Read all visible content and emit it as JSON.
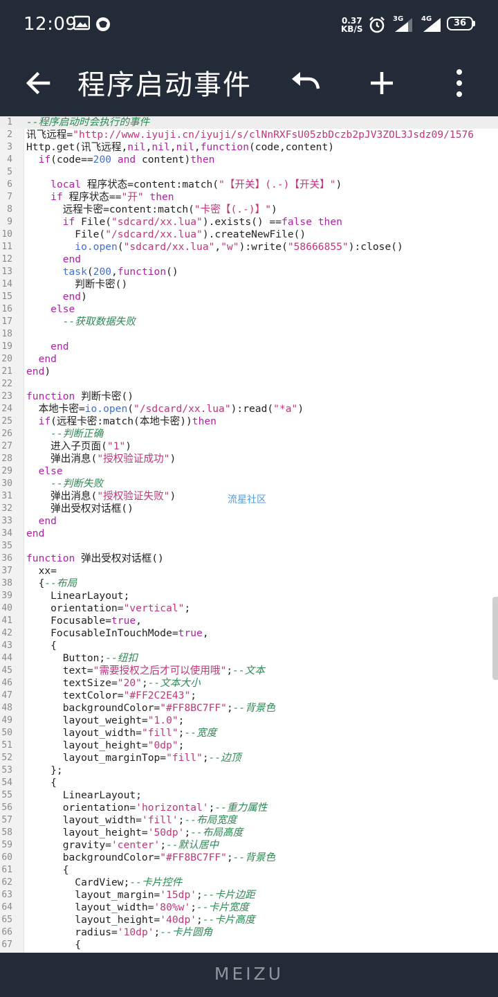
{
  "status_bar": {
    "time": "12:09",
    "net_speed_value": "0.37",
    "net_speed_unit": "KB/S",
    "sim1_label": "3G",
    "sim2_label": "4G",
    "battery": "36",
    "icons": [
      "image-notification-icon",
      "app-notification-icon",
      "alarm-icon",
      "signal-3g-icon",
      "signal-4g-icon",
      "battery-icon"
    ]
  },
  "app_bar": {
    "title": "程序启动事件",
    "icons": [
      "back-arrow-icon",
      "undo-icon",
      "add-icon",
      "more-vert-icon"
    ]
  },
  "editor": {
    "current_line": 1,
    "watermark": "流星社区",
    "lines": [
      [
        [
          "cm",
          "--程序启动时会执行的事件"
        ]
      ],
      [
        [
          "",
          "讯飞远程="
        ],
        [
          "st",
          "\"http://www.iyuji.cn/iyuji/s/clNnRXFsU05zbDczb2pJV3ZOL3Jsdz09/1576"
        ]
      ],
      [
        [
          "",
          "Http.get(讯飞远程,"
        ],
        [
          "kw",
          "nil"
        ],
        [
          "",
          ","
        ],
        [
          "kw",
          "nil"
        ],
        [
          "",
          ","
        ],
        [
          "kw",
          "nil"
        ],
        [
          "",
          ","
        ],
        [
          "kw",
          "function"
        ],
        [
          "",
          "(code,content)"
        ]
      ],
      [
        [
          "",
          "  "
        ],
        [
          "kw",
          "if"
        ],
        [
          "",
          "(code=="
        ],
        [
          "nm",
          "200"
        ],
        [
          "kw",
          " and"
        ],
        [
          "",
          " content)"
        ],
        [
          "kw",
          "then"
        ]
      ],
      [
        [
          "",
          ""
        ]
      ],
      [
        [
          "",
          "    "
        ],
        [
          "kw",
          "local"
        ],
        [
          "",
          " 程序状态=content:match("
        ],
        [
          "st",
          "\"【开关】(.-)【开关】\""
        ],
        [
          "",
          ")"
        ]
      ],
      [
        [
          "",
          "    "
        ],
        [
          "kw",
          "if"
        ],
        [
          "",
          " 程序状态=="
        ],
        [
          "st",
          "\"开\""
        ],
        [
          "kw",
          " then"
        ]
      ],
      [
        [
          "",
          "      远程卡密=content:match("
        ],
        [
          "st",
          "\"卡密【(.-)】\""
        ],
        [
          "",
          ")"
        ]
      ],
      [
        [
          "",
          "      "
        ],
        [
          "kw",
          "if"
        ],
        [
          "",
          " File("
        ],
        [
          "st",
          "\"sdcard/xx.lua\""
        ],
        [
          "",
          ").exists() =="
        ],
        [
          "kw",
          "false"
        ],
        [
          "kw",
          " then"
        ]
      ],
      [
        [
          "",
          "        File("
        ],
        [
          "st",
          "\"/sdcard/xx.lua\""
        ],
        [
          "",
          ").createNewFile()"
        ]
      ],
      [
        [
          "",
          "        "
        ],
        [
          "nm",
          "io.open"
        ],
        [
          "",
          "("
        ],
        [
          "st",
          "\"sdcard/xx.lua\""
        ],
        [
          "",
          ","
        ],
        [
          "st",
          "\"w\""
        ],
        [
          "",
          "):write("
        ],
        [
          "st",
          "\"58666855\""
        ],
        [
          "",
          "):close()"
        ]
      ],
      [
        [
          "",
          "      "
        ],
        [
          "kw",
          "end"
        ]
      ],
      [
        [
          "",
          "      "
        ],
        [
          "nm",
          "task"
        ],
        [
          "",
          "("
        ],
        [
          "nm",
          "200"
        ],
        [
          "",
          ","
        ],
        [
          "kw",
          "function"
        ],
        [
          "",
          "()"
        ]
      ],
      [
        [
          "",
          "        判断卡密()"
        ]
      ],
      [
        [
          "",
          "      "
        ],
        [
          "kw",
          "end"
        ],
        [
          "",
          ")"
        ]
      ],
      [
        [
          "",
          "    "
        ],
        [
          "kw",
          "else"
        ]
      ],
      [
        [
          "",
          "      "
        ],
        [
          "cm",
          "--获取数据失败"
        ]
      ],
      [
        [
          "",
          ""
        ]
      ],
      [
        [
          "",
          "    "
        ],
        [
          "kw",
          "end"
        ]
      ],
      [
        [
          "",
          "  "
        ],
        [
          "kw",
          "end"
        ]
      ],
      [
        [
          "kw",
          "end"
        ],
        [
          "",
          ")"
        ]
      ],
      [
        [
          "",
          ""
        ]
      ],
      [
        [
          "kw",
          "function"
        ],
        [
          "",
          " 判断卡密()"
        ]
      ],
      [
        [
          "",
          "  本地卡密="
        ],
        [
          "nm",
          "io.open"
        ],
        [
          "",
          "("
        ],
        [
          "st",
          "\"/sdcard/xx.lua\""
        ],
        [
          "",
          "):read("
        ],
        [
          "st",
          "\"*a\""
        ],
        [
          "",
          ")"
        ]
      ],
      [
        [
          "",
          "  "
        ],
        [
          "kw",
          "if"
        ],
        [
          "",
          "(远程卡密:match(本地卡密))"
        ],
        [
          "kw",
          "then"
        ]
      ],
      [
        [
          "",
          "    "
        ],
        [
          "cm",
          "--判断正确"
        ]
      ],
      [
        [
          "",
          "    进入子页面("
        ],
        [
          "st",
          "\"1\""
        ],
        [
          "",
          ")"
        ]
      ],
      [
        [
          "",
          "    弹出消息("
        ],
        [
          "st",
          "\"授权验证成功\""
        ],
        [
          "",
          ")"
        ]
      ],
      [
        [
          "",
          "  "
        ],
        [
          "kw",
          "else"
        ]
      ],
      [
        [
          "",
          "    "
        ],
        [
          "cm",
          "--判断失败"
        ]
      ],
      [
        [
          "",
          "    弹出消息("
        ],
        [
          "st",
          "\"授权验证失败\""
        ],
        [
          "",
          ")"
        ]
      ],
      [
        [
          "",
          "    弹出受权对话框()"
        ]
      ],
      [
        [
          "",
          "  "
        ],
        [
          "kw",
          "end"
        ]
      ],
      [
        [
          "kw",
          "end"
        ]
      ],
      [
        [
          "",
          ""
        ]
      ],
      [
        [
          "kw",
          "function"
        ],
        [
          "",
          " 弹出受权对话框()"
        ]
      ],
      [
        [
          "",
          "  xx="
        ]
      ],
      [
        [
          "",
          "  {"
        ],
        [
          "cm",
          "--布局"
        ]
      ],
      [
        [
          "",
          "    LinearLayout;"
        ]
      ],
      [
        [
          "",
          "    orientation="
        ],
        [
          "st",
          "\"vertical\""
        ],
        [
          "",
          ";"
        ]
      ],
      [
        [
          "",
          "    Focusable="
        ],
        [
          "kw",
          "true"
        ],
        [
          "",
          ","
        ]
      ],
      [
        [
          "",
          "    FocusableInTouchMode="
        ],
        [
          "kw",
          "true"
        ],
        [
          "",
          ","
        ]
      ],
      [
        [
          "",
          "    {"
        ]
      ],
      [
        [
          "",
          "      Button;"
        ],
        [
          "cm",
          "--纽扣"
        ]
      ],
      [
        [
          "",
          "      text="
        ],
        [
          "st",
          "\"需要授权之后才可以使用哦\""
        ],
        [
          "",
          ";"
        ],
        [
          "cm",
          "--文本"
        ]
      ],
      [
        [
          "",
          "      textSize="
        ],
        [
          "st",
          "\"20\""
        ],
        [
          "",
          ";"
        ],
        [
          "cm",
          "--文本大小"
        ]
      ],
      [
        [
          "",
          "      textColor="
        ],
        [
          "st",
          "\"#FF2C2E43\""
        ],
        [
          "",
          ";"
        ]
      ],
      [
        [
          "",
          "      backgroundColor="
        ],
        [
          "st",
          "\"#FF8BC7FF\""
        ],
        [
          "",
          ";"
        ],
        [
          "cm",
          "--背景色"
        ]
      ],
      [
        [
          "",
          "      layout_weight="
        ],
        [
          "st",
          "\"1.0\""
        ],
        [
          "",
          ";"
        ]
      ],
      [
        [
          "",
          "      layout_width="
        ],
        [
          "st",
          "\"fill\""
        ],
        [
          "",
          ";"
        ],
        [
          "cm",
          "--宽度"
        ]
      ],
      [
        [
          "",
          "      layout_height="
        ],
        [
          "st",
          "\"0dp\""
        ],
        [
          "",
          ";"
        ]
      ],
      [
        [
          "",
          "      layout_marginTop="
        ],
        [
          "st",
          "\"fill\""
        ],
        [
          "",
          ";"
        ],
        [
          "cm",
          "--边顶"
        ]
      ],
      [
        [
          "",
          "    };"
        ]
      ],
      [
        [
          "",
          "    {"
        ]
      ],
      [
        [
          "",
          "      LinearLayout;"
        ]
      ],
      [
        [
          "",
          "      orientation="
        ],
        [
          "st",
          "'horizontal'"
        ],
        [
          "",
          ";"
        ],
        [
          "cm",
          "--重力属性"
        ]
      ],
      [
        [
          "",
          "      layout_width="
        ],
        [
          "st",
          "'fill'"
        ],
        [
          "",
          ";"
        ],
        [
          "cm",
          "--布局宽度"
        ]
      ],
      [
        [
          "",
          "      layout_height="
        ],
        [
          "st",
          "'50dp'"
        ],
        [
          "",
          ";"
        ],
        [
          "cm",
          "--布局高度"
        ]
      ],
      [
        [
          "",
          "      gravity="
        ],
        [
          "st",
          "'center'"
        ],
        [
          "",
          ";"
        ],
        [
          "cm",
          "--默认居中"
        ]
      ],
      [
        [
          "",
          "      backgroundColor="
        ],
        [
          "st",
          "\"#FF8BC7FF\""
        ],
        [
          "",
          ";"
        ],
        [
          "cm",
          "--背景色"
        ]
      ],
      [
        [
          "",
          "      {"
        ]
      ],
      [
        [
          "",
          "        CardView;"
        ],
        [
          "cm",
          "--卡片控件"
        ]
      ],
      [
        [
          "",
          "        layout_margin="
        ],
        [
          "st",
          "'15dp'"
        ],
        [
          "",
          ";"
        ],
        [
          "cm",
          "--卡片边距"
        ]
      ],
      [
        [
          "",
          "        layout_width="
        ],
        [
          "st",
          "'80%w'"
        ],
        [
          "",
          ";"
        ],
        [
          "cm",
          "--卡片宽度"
        ]
      ],
      [
        [
          "",
          "        layout_height="
        ],
        [
          "st",
          "'40dp'"
        ],
        [
          "",
          ";"
        ],
        [
          "cm",
          "--卡片高度"
        ]
      ],
      [
        [
          "",
          "        radius="
        ],
        [
          "st",
          "'10dp'"
        ],
        [
          "",
          ";"
        ],
        [
          "cm",
          "--卡片圆角"
        ]
      ],
      [
        [
          "",
          "        {"
        ]
      ]
    ]
  },
  "nav_bar": {
    "brand": "MEIZU"
  }
}
